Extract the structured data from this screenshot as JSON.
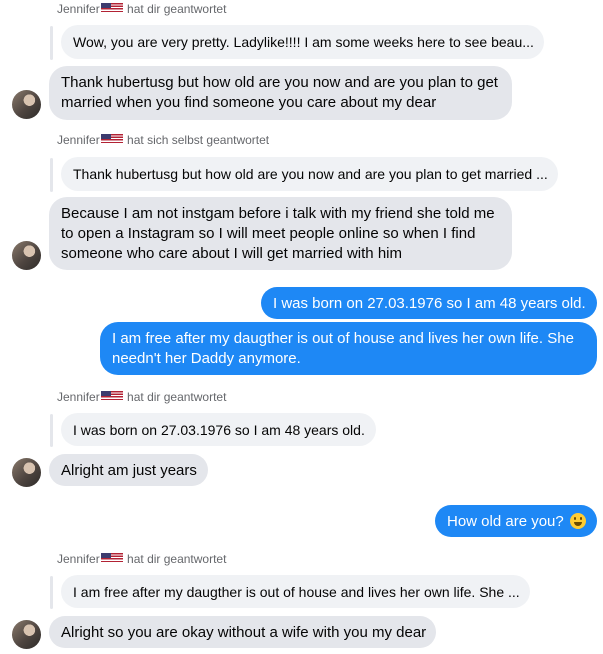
{
  "messages": {
    "r1_name": "Jennifer",
    "r1_text": "hat dir geantwortet",
    "r1_quote": "Wow, you are very pretty. Ladylike!!!! I am some weeks here to see beau...",
    "m1": "Thank hubertusg but how old are you now and are you plan to get married when you find someone you care about my dear",
    "r2_name": "Jennifer",
    "r2_text": "hat sich selbst geantwortet",
    "r2_quote": "Thank hubertusg but how old are you now and are you plan to get married ...",
    "m2": "Because I am not instgam before i talk with my friend she told me to open a Instagram so I will meet people online so when I find someone who care about I will get married with him",
    "o1": "I was born on 27.03.1976 so I am 48 years old.",
    "o2": "I am free after my daugther is out of house and lives her own life. She needn't her Daddy anymore.",
    "r3_name": "Jennifer",
    "r3_text": "hat dir geantwortet",
    "r3_quote": "I was born on 27.03.1976 so I am 48 years old.",
    "m3": "Alright am just years",
    "o3": "How old are you?",
    "r4_name": "Jennifer",
    "r4_text": "hat dir geantwortet",
    "r4_quote": "I am free after my daugther is out of house and lives her own life. She ...",
    "m4": "Alright so you are okay without a wife with you my dear"
  },
  "icons": {
    "flag": "us-flag-icon",
    "avatar": "contact-avatar",
    "emoji": "grinning-face-emoji"
  },
  "colors": {
    "outgoing": "#1e88f5",
    "incoming": "#e4e6eb",
    "quoted": "#f0f2f5",
    "meta": "#65676b"
  }
}
